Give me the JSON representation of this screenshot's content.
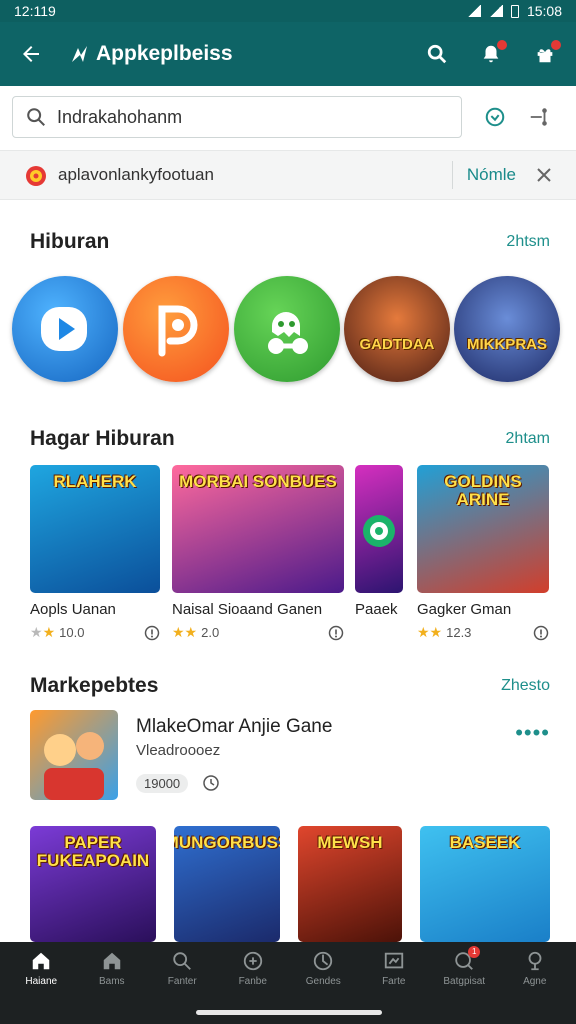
{
  "status_bar": {
    "time": "12:119",
    "clock_right": "15:08"
  },
  "app_bar": {
    "title": "Appkeplbeiss"
  },
  "search": {
    "placeholder": "Indrakahohanm",
    "value": ""
  },
  "banner": {
    "text": "aplavonlankyfootuan",
    "link_label": "Nómle"
  },
  "sections": {
    "entertainment": {
      "title": "Hiburan",
      "more": "2htsm",
      "circles": [
        {
          "name": "Video player app",
          "icon": "play-icon",
          "color": "#1e88e5"
        },
        {
          "name": "P app",
          "icon": "p-letter-icon",
          "color": "#ff6d1f"
        },
        {
          "name": "Ghost app",
          "icon": "ghost-icon",
          "color": "#38b03a"
        },
        {
          "name": "Game 1",
          "label": "GADTDAA",
          "color": "#b83221"
        },
        {
          "name": "Game 2",
          "label": "MIKKPRAS",
          "color": "#3a4db5"
        }
      ]
    },
    "cheap_entertainment": {
      "title": "Hagar Hiburan",
      "more": "2htam",
      "cards": [
        {
          "thumb_text": "RLAHERK",
          "name": "Aopls Uanan",
          "rating": "10.0",
          "stars_on": 1
        },
        {
          "thumb_text": "MORBAI SONBUES",
          "name": "Naisal Sioaand Ganen",
          "rating": "2.0",
          "stars_on": 2
        },
        {
          "thumb_text": "",
          "name": "Paaek",
          "rating": "",
          "stars_on": 0
        },
        {
          "thumb_text": "GOLDINS ARINE",
          "name": "Gagker Gman",
          "rating": "12.3",
          "stars_on": 2
        }
      ]
    },
    "market": {
      "title": "Markepebtes",
      "more": "Zhesto",
      "featured": {
        "title": "MlakeOmar Anjie Gane",
        "subtitle": "Vleadroooez",
        "chip": "19000"
      },
      "bottom_thumbs": [
        {
          "text": "PAPER FUKEAPOAIN"
        },
        {
          "text": "MUNGORBUSS"
        },
        {
          "text": "MEWSH"
        },
        {
          "text": "BASEEK"
        }
      ]
    }
  },
  "bottom_nav": [
    {
      "label": "Haiane",
      "icon": "home-icon",
      "active": true
    },
    {
      "label": "Bams",
      "icon": "house-icon"
    },
    {
      "label": "Fanter",
      "icon": "search-icon"
    },
    {
      "label": "Fanbe",
      "icon": "target-icon"
    },
    {
      "label": "Gendes",
      "icon": "compass-icon"
    },
    {
      "label": "Farte",
      "icon": "chart-icon"
    },
    {
      "label": "Batgpisat",
      "icon": "chat-icon",
      "badge": "1"
    },
    {
      "label": "Agne",
      "icon": "pin-icon"
    }
  ],
  "colors": {
    "primary": "#0e6466",
    "accent": "#1e8f8b",
    "nav_bg": "#1d2122"
  }
}
